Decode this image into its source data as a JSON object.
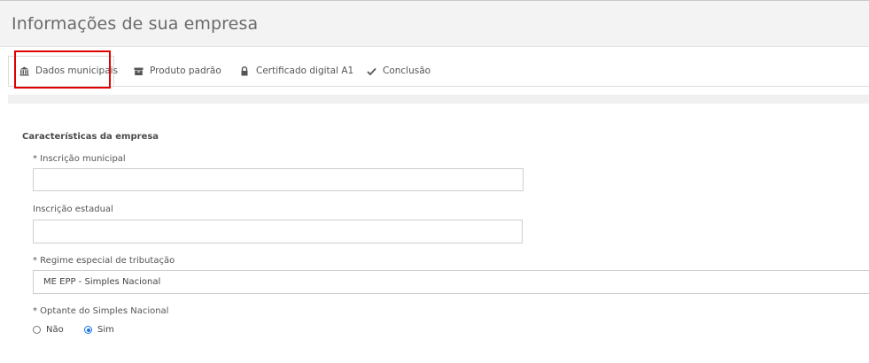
{
  "header": {
    "title": "Informações de sua empresa"
  },
  "tabs": [
    {
      "label": "Dados municipais",
      "icon": "bank-icon",
      "active": true
    },
    {
      "label": "Produto padrão",
      "icon": "box-icon",
      "active": false
    },
    {
      "label": "Certificado digital A1",
      "icon": "lock-icon",
      "active": false
    },
    {
      "label": "Conclusão",
      "icon": "check-icon",
      "active": false
    }
  ],
  "section": {
    "title": "Características da empresa"
  },
  "fields": {
    "inscricao_municipal": {
      "label": "* Inscrição municipal",
      "value": ""
    },
    "inscricao_estadual": {
      "label": "Inscrição estadual",
      "value": ""
    },
    "regime": {
      "label": "* Regime especial de tributação",
      "value": "ME EPP - Simples Nacional"
    },
    "optante": {
      "label": "* Optante do Simples Nacional",
      "options": [
        "Não",
        "Sim"
      ],
      "selected": "Sim"
    }
  },
  "colors": {
    "highlight": "#e00000",
    "radio_accent": "#1a73e8",
    "header_bg": "#f3f3f3"
  }
}
